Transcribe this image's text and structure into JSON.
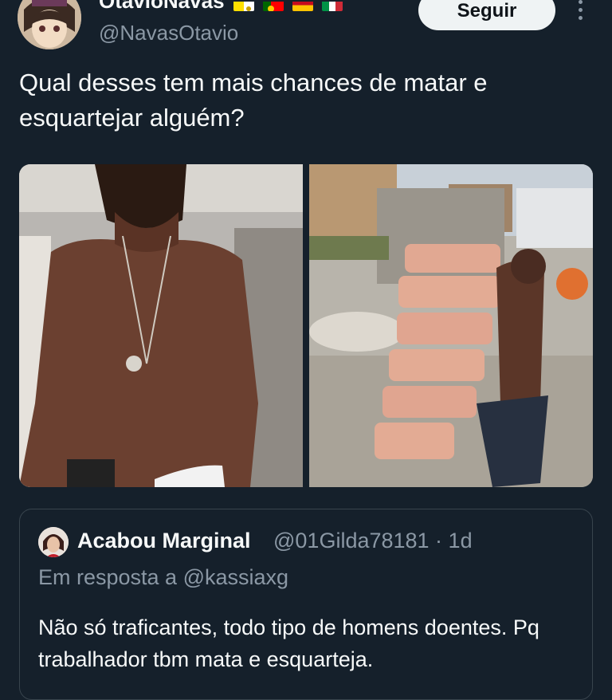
{
  "author": {
    "display_name": "OtavioNavas",
    "handle": "@NavasOtavio",
    "avatar_icon": "anime-avatar-icon",
    "flags": [
      "vatican-flag-icon",
      "portugal-flag-icon",
      "spain-flag-icon",
      "italy-flag-icon"
    ]
  },
  "actions": {
    "follow_label": "Seguir",
    "more_icon": "more-vertical-icon"
  },
  "tweet": {
    "text": "Qual desses tem mais chances de matar e esquartejar alguém?"
  },
  "media": {
    "photos": [
      "photo-left",
      "photo-right"
    ]
  },
  "quote": {
    "display_name": "Acabou Marginal",
    "handle_time": "@01Gilda78181 · 1d",
    "reply_to": "Em resposta a @kassiaxg",
    "text": "Não só traficantes, todo tipo de homens doentes. Pq trabalhador tbm mata e esquarteja."
  },
  "colors": {
    "background": "#15202b",
    "text": "#f7f9f9",
    "secondary": "#8b98a5",
    "border": "#38444d",
    "button_bg": "#eff3f4"
  }
}
